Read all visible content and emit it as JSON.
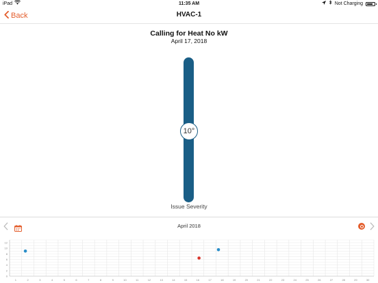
{
  "status_bar": {
    "device": "iPad",
    "time": "11:35 AM",
    "charging": "Not Charging",
    "battery_level": 0.8
  },
  "nav": {
    "back_label": "Back",
    "title": "HVAC-1"
  },
  "alert": {
    "title": "Calling for Heat No kW",
    "date": "April 17, 2018"
  },
  "severity": {
    "value": "10°",
    "level": 0.5,
    "label": "Issue Severity"
  },
  "calendar": {
    "month": "April 2018"
  },
  "colors": {
    "accent": "#e35d2c",
    "gauge": "#1a5e86",
    "blue_point": "#2a8ec9",
    "red_point": "#d9342b"
  },
  "chart_data": {
    "type": "scatter",
    "x": [
      "1",
      "2",
      "3",
      "4",
      "5",
      "6",
      "7",
      "8",
      "9",
      "10",
      "11",
      "12",
      "13",
      "14",
      "15",
      "16",
      "17",
      "18",
      "19",
      "20",
      "21",
      "22",
      "23",
      "24",
      "25",
      "26",
      "27",
      "28",
      "29",
      "30"
    ],
    "y_ticks": [
      "0",
      "2",
      "4",
      "6",
      "8",
      "10",
      "12"
    ],
    "xlim": [
      0,
      30
    ],
    "ylim": [
      0,
      13
    ],
    "points": [
      {
        "x": 1.3,
        "y": 9,
        "color": "#2a8ec9"
      },
      {
        "x": 15.6,
        "y": 6.5,
        "color": "#d9342b"
      },
      {
        "x": 17.2,
        "y": 9.5,
        "color": "#2a8ec9"
      }
    ],
    "grid": true
  }
}
